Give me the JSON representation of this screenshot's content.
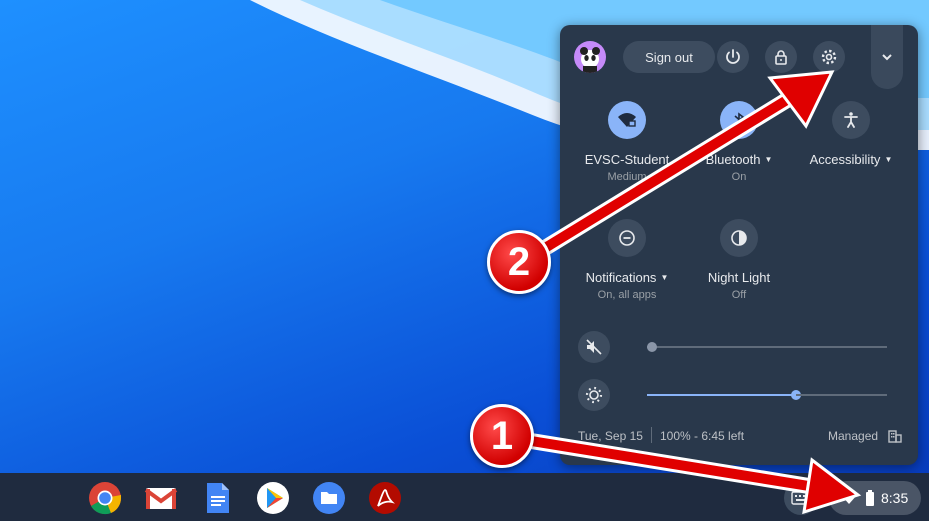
{
  "quick_settings": {
    "sign_out": "Sign out",
    "network": {
      "label": "EVSC-Student",
      "status": "Medium"
    },
    "bluetooth": {
      "label": "Bluetooth",
      "status": "On"
    },
    "accessibility": {
      "label": "Accessibility"
    },
    "notifications": {
      "label": "Notifications",
      "status": "On, all apps"
    },
    "night_light": {
      "label": "Night Light",
      "status": "Off"
    },
    "volume_level": 0,
    "brightness_level": 0.62,
    "date": "Tue, Sep 15",
    "battery": "100% - 6:45 left",
    "managed": "Managed"
  },
  "shelf": {
    "apps": [
      "chrome-icon",
      "gmail-icon",
      "docs-icon",
      "play-store-icon",
      "files-icon",
      "acrobat-icon"
    ],
    "time": "8:35"
  },
  "annotations": {
    "badge_1": "1",
    "badge_2": "2"
  },
  "colors": {
    "accent": "#8ab4f8",
    "panel": "#29384b",
    "shelf": "#1f2b3f",
    "annotation": "#e00000"
  }
}
